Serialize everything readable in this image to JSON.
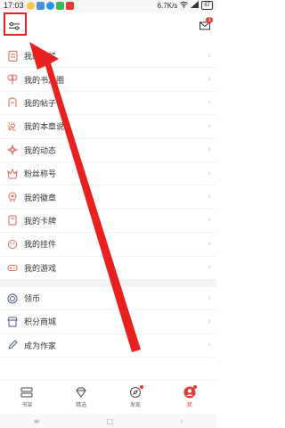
{
  "status_bar": {
    "time": "17:03",
    "speed": "6.7K/s",
    "battery": "87"
  },
  "menu_items": [
    {
      "label": "我的专栏",
      "icon": "column-icon"
    },
    {
      "label": "我的书友圈",
      "icon": "circle-icon"
    },
    {
      "label": "我的帖子",
      "icon": "post-icon"
    },
    {
      "label": "我的本章说",
      "icon": "comment-icon"
    },
    {
      "label": "我的动态",
      "icon": "activity-icon"
    },
    {
      "label": "粉丝称号",
      "icon": "fan-icon"
    },
    {
      "label": "我的徽章",
      "icon": "badge-icon"
    },
    {
      "label": "我的卡牌",
      "icon": "card-icon"
    },
    {
      "label": "我的挂件",
      "icon": "pendant-icon"
    },
    {
      "label": "我的游戏",
      "icon": "game-icon"
    }
  ],
  "menu_items_2": [
    {
      "label": "领币",
      "icon": "coin-icon"
    },
    {
      "label": "积分商城",
      "icon": "shop-icon"
    },
    {
      "label": "成为作家",
      "icon": "pen-icon"
    }
  ],
  "tabs": [
    {
      "label": "书架",
      "icon": "bookshelf-icon",
      "active": false,
      "dot": false
    },
    {
      "label": "精选",
      "icon": "diamond-icon",
      "active": false,
      "dot": false
    },
    {
      "label": "发现",
      "icon": "compass-icon",
      "active": false,
      "dot": true
    },
    {
      "label": "我",
      "icon": "profile-icon",
      "active": true,
      "dot": true
    }
  ],
  "colors": {
    "accent": "#e53935",
    "annotation": "#e82020",
    "icon": "#e06a5a"
  }
}
